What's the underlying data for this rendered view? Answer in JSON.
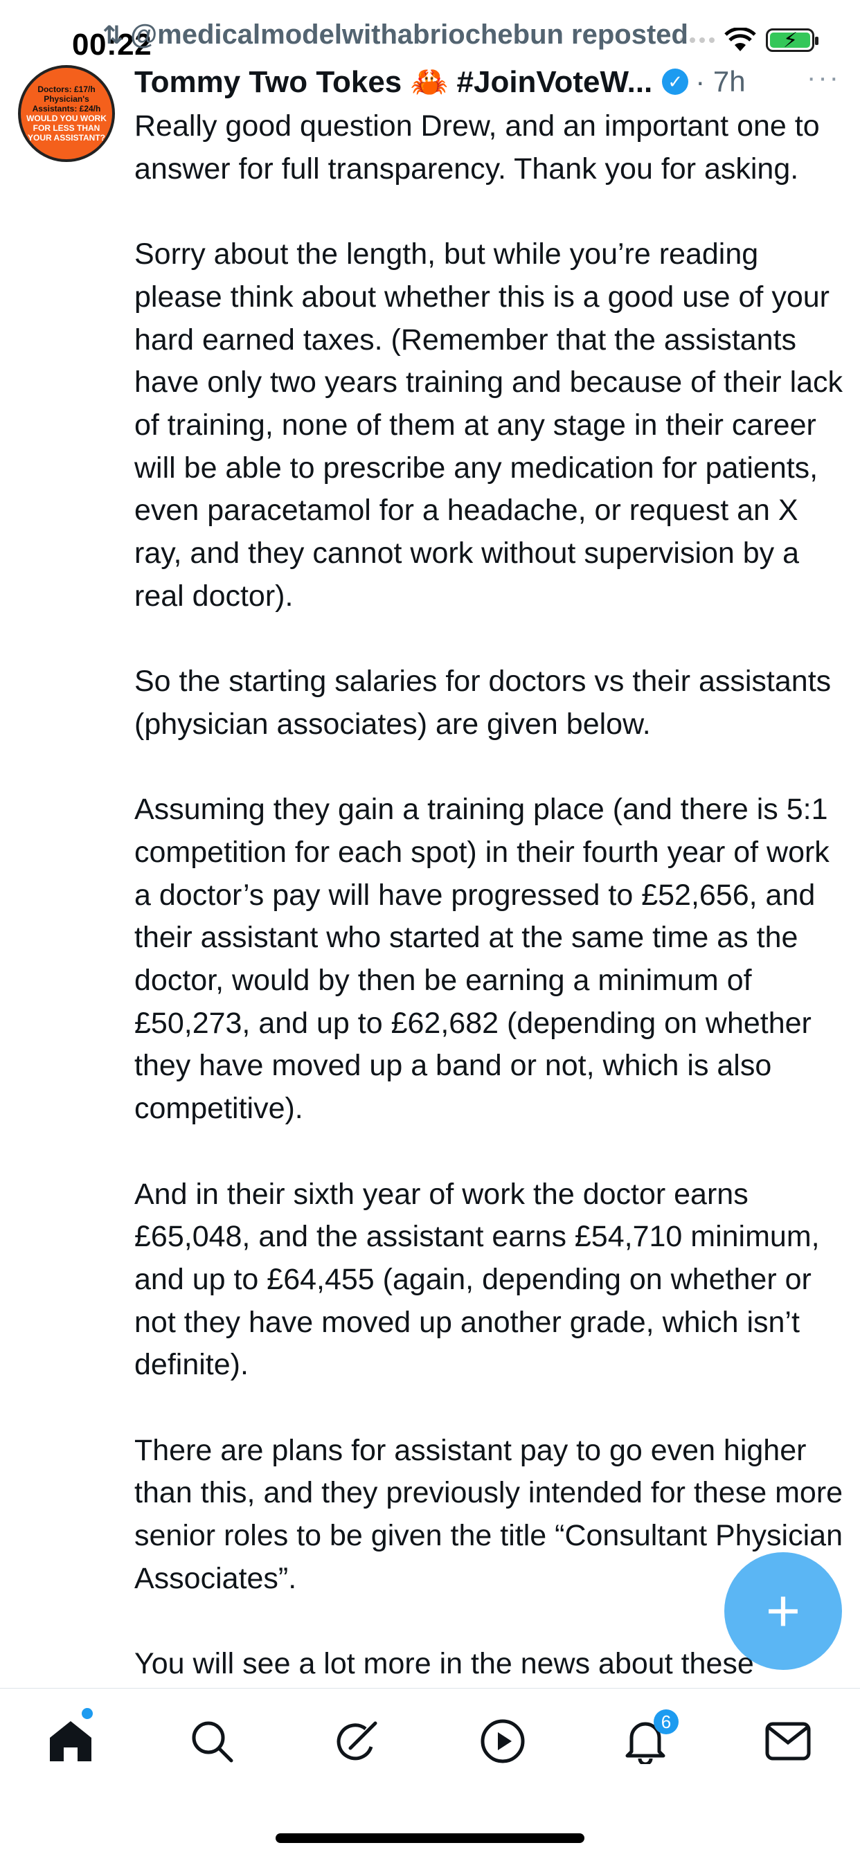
{
  "status_bar": {
    "time": "00:22",
    "icons": [
      "signal-dots-icon",
      "wifi-icon",
      "battery-charging-icon"
    ],
    "battery_color": "#34c759"
  },
  "repost_label": "@medicalmodelwithabriochebun reposted",
  "tweet": {
    "avatar_text": [
      "Doctors: £17/h",
      "Physician's",
      "Assistants: £24/h",
      "WOULD YOU WORK",
      "FOR LESS THAN",
      "YOUR ASSISTANT?"
    ],
    "display_name": "Tommy Two Tokes 🦀 #JoinVoteW...",
    "meta": "· 7h",
    "more": "···",
    "paragraphs": [
      "Really good question Drew, and an important one to answer for full transparency. Thank you for asking.",
      "Sorry about the length, but while you’re reading please think about whether this is a good use of your hard earned taxes. (Remember that the assistants have only two years training and because of their lack of training, none of them at any stage in their career will be able to prescribe any medication for patients, even paracetamol for a headache, or request an X ray, and they cannot work without supervision by a real doctor).",
      "So the starting salaries for doctors vs their assistants (physician associates) are given below.",
      "Assuming they gain a training place (and there is 5:1 competition for each spot) in their fourth year of work a doctor’s pay will have progressed to £52,656, and their assistant who started at the same time as the doctor, would by then be earning a minimum of £50,273, and up to £62,682 (depending on whether they have moved up a band or not, which is also competitive).",
      "And in their sixth year of work the doctor earns £65,048, and the assistant earns £54,710 minimum, and up to £64,455 (again, depending on whether or not they have moved up another grade, which isn’t definite).",
      "There are plans for assistant pay to go even higher than this, and they previously intended for these more senior roles to be given the title “Consultant Physician Associates”.",
      "You will see a lot more in the news about these"
    ]
  },
  "fab": {
    "label": "+",
    "icon": "compose-plus-icon",
    "color": "#1d9bf0"
  },
  "bottom_nav": {
    "items": [
      "home-icon",
      "search-icon",
      "grok-icon",
      "video-icon",
      "notifications-icon",
      "messages-icon"
    ],
    "notification_count": "6",
    "accent": "#1d9bf0"
  }
}
